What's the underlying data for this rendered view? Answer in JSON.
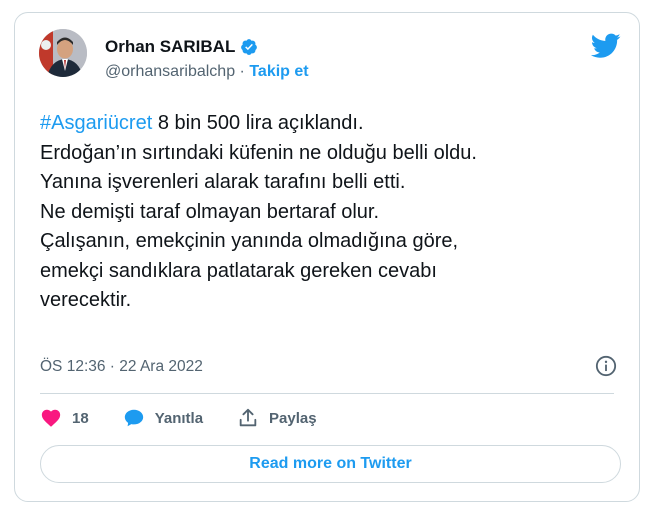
{
  "author": {
    "name": "Orhan SARIBAL",
    "handle": "@orhansaribalchp",
    "separator": "·",
    "follow_label": "Takip et",
    "verified_icon": "verified-badge-icon"
  },
  "brand": {
    "logo_icon": "twitter-bird-icon",
    "accent_color": "#1d9bf0"
  },
  "tweet": {
    "hashtag": "#Asgariücret",
    "first_line_rest": " 8 bin 500 lira açıklandı.",
    "body": "\nErdoğan’ın sırtındaki küfenin ne olduğu belli oldu.\nYanına işverenleri alarak tarafını belli etti.\nNe demişti taraf olmayan bertaraf olur.\nÇalışanın, emekçinin yanında olmadığına göre,\nemekçi sandıklara patlatarak gereken cevabı\nverecektir."
  },
  "meta": {
    "timestamp": "ÖS 12:36 · 22 Ara 2022",
    "info_icon": "info-icon"
  },
  "actions": {
    "like": {
      "icon": "heart-icon",
      "count": "18",
      "color": "#f91880"
    },
    "reply": {
      "icon": "reply-bubble-icon",
      "label": "Yanıtla"
    },
    "share": {
      "icon": "share-icon",
      "label": "Paylaş"
    }
  },
  "read_more_label": "Read more on Twitter"
}
